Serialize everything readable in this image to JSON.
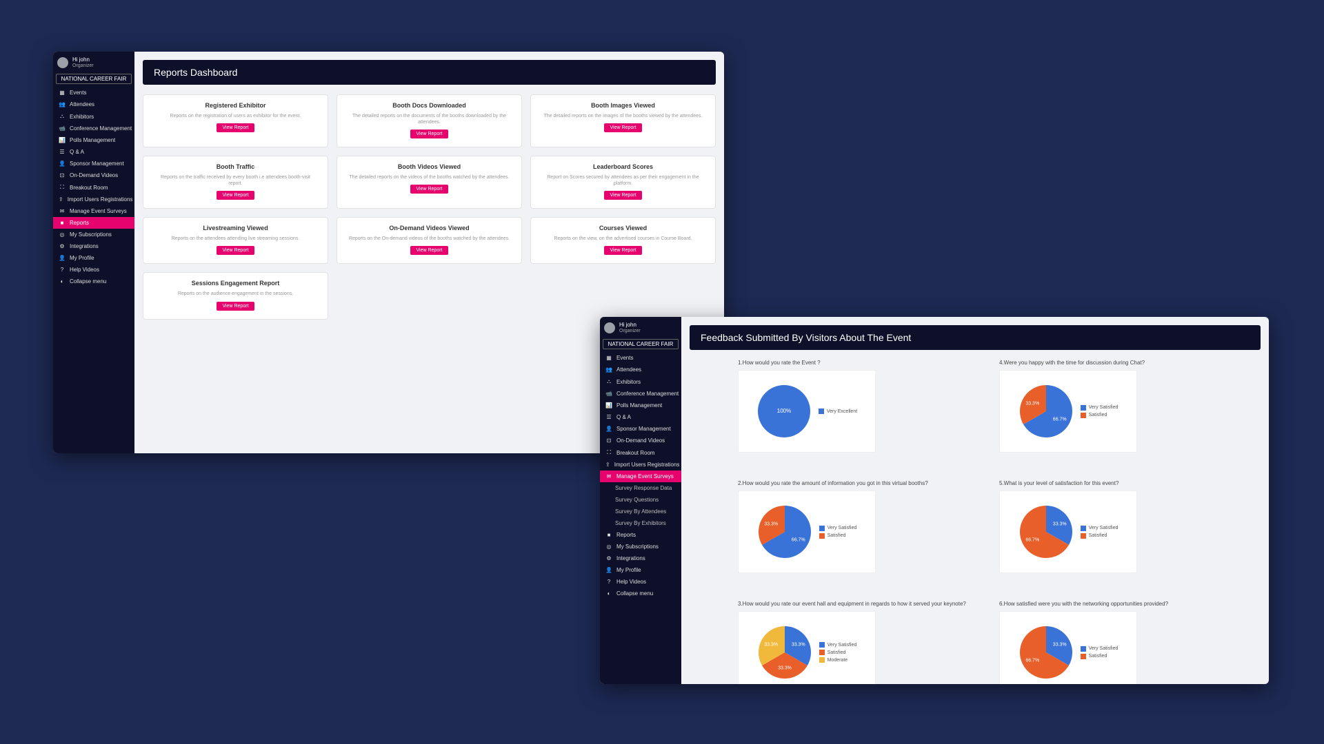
{
  "colors": {
    "accent": "#e6036d",
    "dark": "#0d1028",
    "blue": "#3a73d8",
    "orange": "#e85f2a"
  },
  "user": {
    "greeting": "Hi john",
    "role": "Organizer"
  },
  "eventLabel": "NATIONAL CAREER FAIR",
  "nav1": [
    {
      "icon": "calendar-icon",
      "glyph": "▦",
      "label": "Events"
    },
    {
      "icon": "attendees-icon",
      "glyph": "👥",
      "label": "Attendees"
    },
    {
      "icon": "exhibitors-icon",
      "glyph": "⛬",
      "label": "Exhibitors"
    },
    {
      "icon": "conference-icon",
      "glyph": "📹",
      "label": "Conference Management"
    },
    {
      "icon": "polls-icon",
      "glyph": "📊",
      "label": "Polls Management"
    },
    {
      "icon": "qa-icon",
      "glyph": "☰",
      "label": "Q & A"
    },
    {
      "icon": "sponsor-icon",
      "glyph": "👤",
      "label": "Sponsor Management"
    },
    {
      "icon": "video-icon",
      "glyph": "⊡",
      "label": "On-Demand Videos"
    },
    {
      "icon": "breakout-icon",
      "glyph": "⛶",
      "label": "Breakout Room"
    },
    {
      "icon": "import-icon",
      "glyph": "⇪",
      "label": "Import Users Registrations"
    },
    {
      "icon": "survey-icon",
      "glyph": "✉",
      "label": "Manage Event Surveys"
    },
    {
      "icon": "reports-icon",
      "glyph": "■",
      "label": "Reports",
      "active": true
    },
    {
      "icon": "subscriptions-icon",
      "glyph": "◎",
      "label": "My Subscriptions"
    },
    {
      "icon": "integrations-icon",
      "glyph": "⚙",
      "label": "Integrations"
    },
    {
      "icon": "profile-icon",
      "glyph": "👤",
      "label": "My Profile"
    },
    {
      "icon": "help-icon",
      "glyph": "?",
      "label": "Help Videos"
    },
    {
      "icon": "collapse-icon",
      "glyph": "◐",
      "label": "Collapse menu"
    }
  ],
  "nav2": [
    {
      "icon": "calendar-icon",
      "glyph": "▦",
      "label": "Events"
    },
    {
      "icon": "attendees-icon",
      "glyph": "👥",
      "label": "Attendees"
    },
    {
      "icon": "exhibitors-icon",
      "glyph": "⛬",
      "label": "Exhibitors"
    },
    {
      "icon": "conference-icon",
      "glyph": "📹",
      "label": "Conference Management"
    },
    {
      "icon": "polls-icon",
      "glyph": "📊",
      "label": "Polls Management"
    },
    {
      "icon": "qa-icon",
      "glyph": "☰",
      "label": "Q & A"
    },
    {
      "icon": "sponsor-icon",
      "glyph": "👤",
      "label": "Sponsor Management"
    },
    {
      "icon": "video-icon",
      "glyph": "⊡",
      "label": "On-Demand Videos"
    },
    {
      "icon": "breakout-icon",
      "glyph": "⛶",
      "label": "Breakout Room"
    },
    {
      "icon": "import-icon",
      "glyph": "⇪",
      "label": "Import Users Registrations"
    },
    {
      "icon": "survey-icon",
      "glyph": "✉",
      "label": "Manage Event Surveys",
      "active": true
    },
    {
      "sub": true,
      "label": "Survey Response Data"
    },
    {
      "sub": true,
      "label": "Survey Questions"
    },
    {
      "sub": true,
      "label": "Survey By Attendees"
    },
    {
      "sub": true,
      "label": "Survey By Exhibitors"
    },
    {
      "icon": "reports-icon",
      "glyph": "■",
      "label": "Reports"
    },
    {
      "icon": "subscriptions-icon",
      "glyph": "◎",
      "label": "My Subscriptions"
    },
    {
      "icon": "integrations-icon",
      "glyph": "⚙",
      "label": "Integrations"
    },
    {
      "icon": "profile-icon",
      "glyph": "👤",
      "label": "My Profile"
    },
    {
      "icon": "help-icon",
      "glyph": "?",
      "label": "Help Videos"
    },
    {
      "icon": "collapse-icon",
      "glyph": "◐",
      "label": "Collapse menu"
    }
  ],
  "dashboard": {
    "title": "Reports Dashboard",
    "btn": "View Report",
    "cards": [
      {
        "title": "Registered Exhibitor",
        "desc": "Reports on the registration of users as exhibitor for the event."
      },
      {
        "title": "Booth Docs Downloaded",
        "desc": "The detailed reports on the documents of the booths downloaded by the attendees."
      },
      {
        "title": "Booth Images Viewed",
        "desc": "The detailed reports on the images of the booths viewed by the attendees."
      },
      {
        "title": "Booth Traffic",
        "desc": "Reports on the traffic received by every booth i.e attendees booth-visit report."
      },
      {
        "title": "Booth Videos Viewed",
        "desc": "The detailed reports on the videos of the booths watched by the attendees."
      },
      {
        "title": "Leaderboard Scores",
        "desc": "Report on Scores secured by attendees as per their engagement in the platform."
      },
      {
        "title": "Livestreaming Viewed",
        "desc": "Reports on the attendees attending live streaming sessions."
      },
      {
        "title": "On-Demand Videos Viewed",
        "desc": "Reports on the On-demand videos of the booths watched by the attendees."
      },
      {
        "title": "Courses Viewed",
        "desc": "Reports on the view, on the advertised courses in Course Board."
      },
      {
        "title": "Sessions Engagement Report",
        "desc": "Reports on the audience engagement in the sessions."
      }
    ]
  },
  "feedback": {
    "title": "Feedback Submitted By Visitors About The Event",
    "questions": [
      {
        "n": "1",
        "text": "How would you rate the Event ?"
      },
      {
        "n": "4",
        "text": "Were you happy with the time for discussion during Chat?"
      },
      {
        "n": "2",
        "text": "How would you rate the amount of information you got in this virtual booths?"
      },
      {
        "n": "5",
        "text": "What is your level of satisfaction for this event?"
      },
      {
        "n": "3",
        "text": "How would you rate our event hall and equipment in regards to how it served your keynote?"
      },
      {
        "n": "6",
        "text": "How satisfied were you with the networking opportunities provided?"
      }
    ]
  },
  "chart_data": [
    {
      "type": "pie",
      "title": "1.How would you rate the Event ?",
      "series": [
        {
          "name": "Very Excellent",
          "value": 100,
          "color": "#3a73d8"
        }
      ],
      "center_label": "100%"
    },
    {
      "type": "pie",
      "title": "4.Were you happy with the time for discussion during Chat?",
      "series": [
        {
          "name": "Very Satisfied",
          "value": 66.7,
          "color": "#3a73d8"
        },
        {
          "name": "Satisfied",
          "value": 33.3,
          "color": "#e85f2a"
        }
      ],
      "slice_labels": [
        "66.7%",
        "33.3%"
      ]
    },
    {
      "type": "pie",
      "title": "2.How would you rate the amount of information you got in this virtual booths?",
      "series": [
        {
          "name": "Very Satisfied",
          "value": 66.7,
          "color": "#3a73d8"
        },
        {
          "name": "Satisfied",
          "value": 33.3,
          "color": "#e85f2a"
        }
      ],
      "slice_labels": [
        "66.7%",
        "33.3%"
      ]
    },
    {
      "type": "pie",
      "title": "5.What is your level of satisfaction for this event?",
      "series": [
        {
          "name": "Very Satisfied",
          "value": 33.3,
          "color": "#3a73d8"
        },
        {
          "name": "Satisfied",
          "value": 66.7,
          "color": "#e85f2a"
        }
      ],
      "slice_labels": [
        "33.3%",
        "66.7%"
      ]
    },
    {
      "type": "pie",
      "title": "3.How would you rate our event hall and equipment in regards to how it served your keynote?",
      "series": [
        {
          "name": "Very Satisfied",
          "value": 33.3,
          "color": "#3a73d8"
        },
        {
          "name": "Satisfied",
          "value": 33.3,
          "color": "#e85f2a"
        },
        {
          "name": "Moderate",
          "value": 33.3,
          "color": "#f0b93b"
        }
      ],
      "slice_labels": [
        "33.3%",
        "33.3%",
        "33.3%"
      ]
    },
    {
      "type": "pie",
      "title": "6.How satisfied were you with the networking opportunities provided?",
      "series": [
        {
          "name": "Very Satisfied",
          "value": 33.3,
          "color": "#3a73d8"
        },
        {
          "name": "Satisfied",
          "value": 66.7,
          "color": "#e85f2a"
        }
      ],
      "slice_labels": [
        "33.3%",
        "66.7%"
      ]
    }
  ]
}
